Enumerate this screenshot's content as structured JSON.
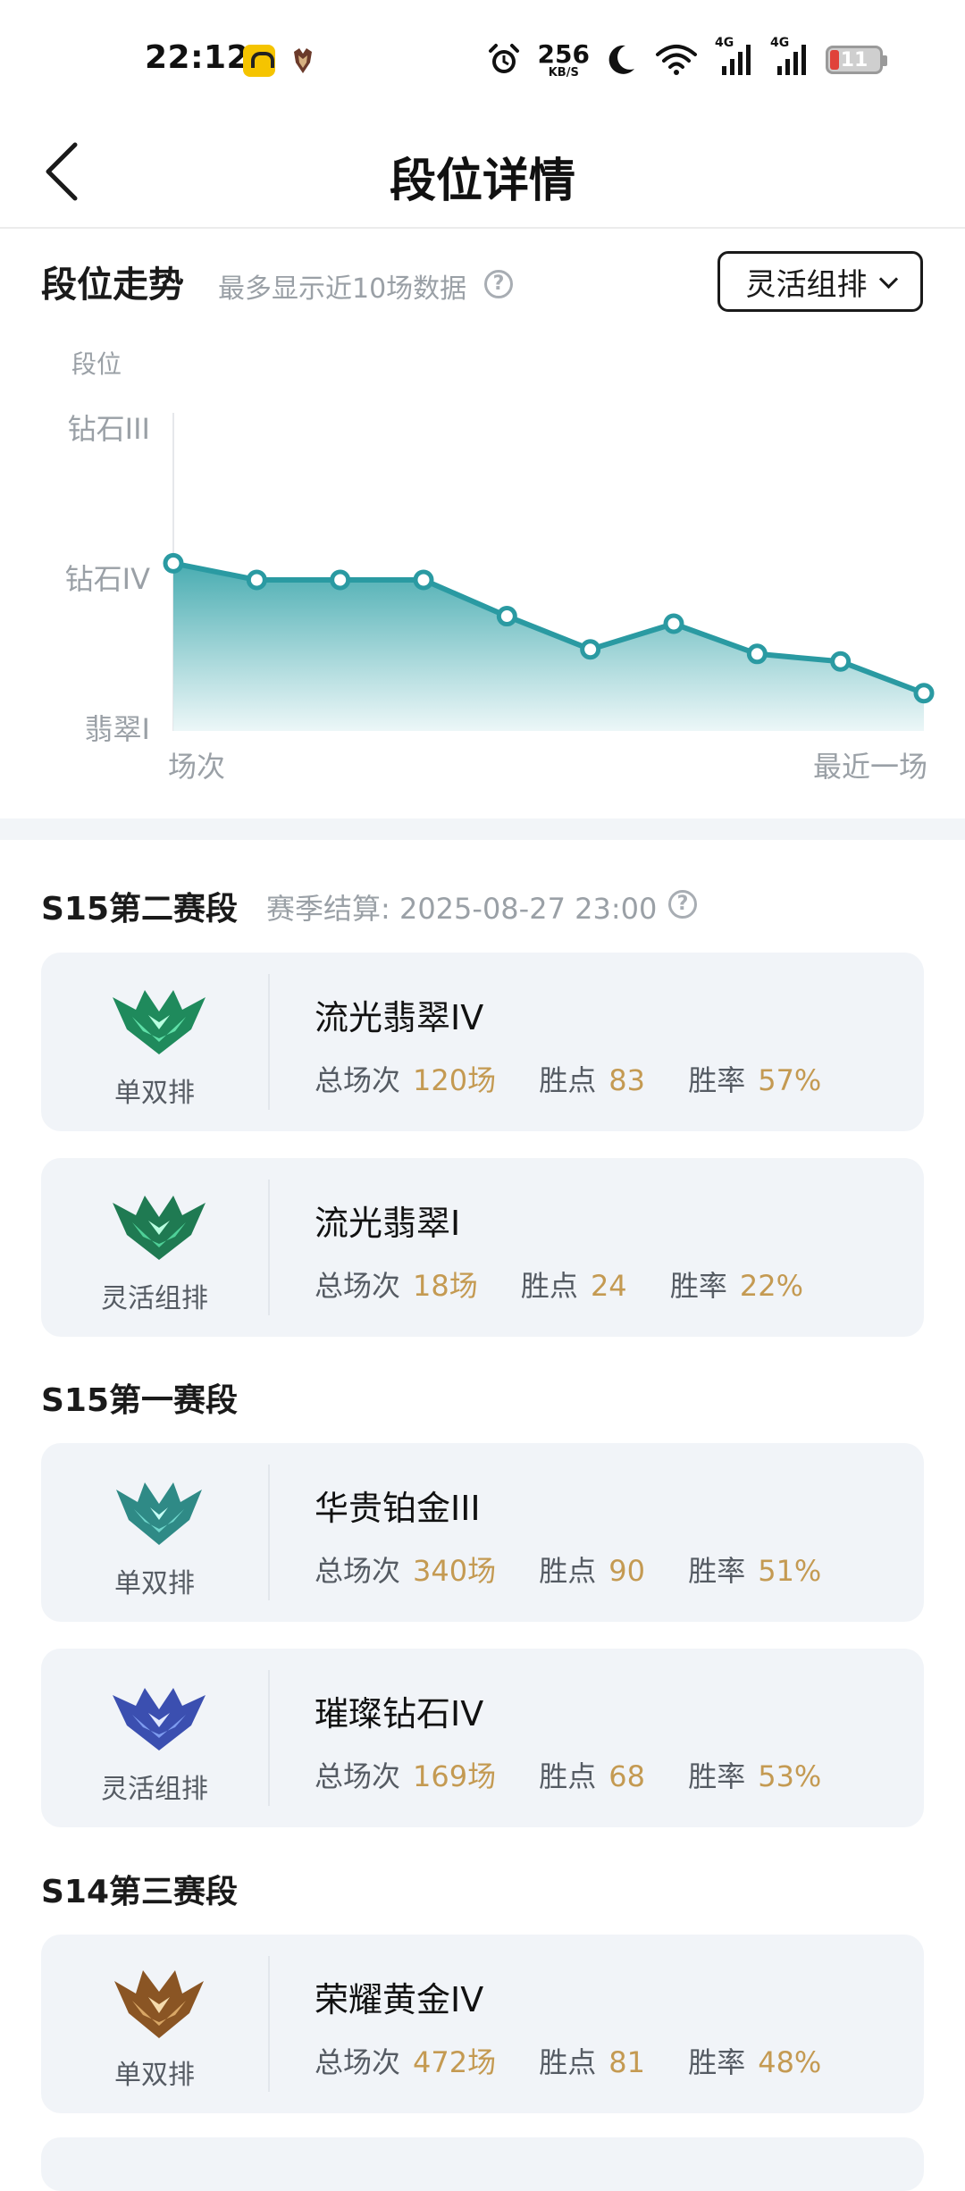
{
  "status_bar": {
    "time": "22:12",
    "net_speed_value": "256",
    "net_speed_unit": "KB/S",
    "signal1_label": "4G",
    "signal2_label": "4G",
    "battery_level": "11"
  },
  "header": {
    "title": "段位详情"
  },
  "trend": {
    "title": "段位走势",
    "subtitle": "最多显示近10场数据",
    "help_symbol": "?",
    "mode_selected": "灵活组排",
    "y_axis_title": "段位",
    "x_start_label": "场次",
    "x_end_label": "最近一场"
  },
  "chart_data": {
    "type": "area",
    "ylabel": "段位",
    "y_ticks": [
      "翡翠I",
      "钻石IV",
      "钻石III"
    ],
    "y_range": [
      0,
      2
    ],
    "x_start_label": "场次",
    "x_end_label": "最近一场",
    "values": [
      1.11,
      1.0,
      1.0,
      1.0,
      0.76,
      0.54,
      0.71,
      0.51,
      0.46,
      0.25
    ],
    "line_color": "#2a9aa2",
    "fill_color_top": "#3fa8ad",
    "fill_color_bottom": "#eaf6f7"
  },
  "seasons": [
    {
      "name": "S15第二赛段",
      "note": "赛季结算: 2025-08-27 23:00",
      "cards": [
        {
          "emblem": "emerald-emblem-icon",
          "queue": "单双排",
          "rank": "流光翡翠IV",
          "games_label": "总场次",
          "games": "120场",
          "lp_label": "胜点",
          "lp": "83",
          "wr_label": "胜率",
          "winrate": "57%"
        },
        {
          "emblem": "emerald-emblem-icon",
          "queue": "灵活组排",
          "rank": "流光翡翠I",
          "games_label": "总场次",
          "games": "18场",
          "lp_label": "胜点",
          "lp": "24",
          "wr_label": "胜率",
          "winrate": "22%"
        }
      ]
    },
    {
      "name": "S15第一赛段",
      "cards": [
        {
          "emblem": "platinum-emblem-icon",
          "queue": "单双排",
          "rank": "华贵铂金III",
          "games_label": "总场次",
          "games": "340场",
          "lp_label": "胜点",
          "lp": "90",
          "wr_label": "胜率",
          "winrate": "51%"
        },
        {
          "emblem": "diamond-emblem-icon",
          "queue": "灵活组排",
          "rank": "璀璨钻石IV",
          "games_label": "总场次",
          "games": "169场",
          "lp_label": "胜点",
          "lp": "68",
          "wr_label": "胜率",
          "winrate": "53%"
        }
      ]
    },
    {
      "name": "S14第三赛段",
      "cards": [
        {
          "emblem": "gold-emblem-icon",
          "queue": "单双排",
          "rank": "荣耀黄金IV",
          "games_label": "总场次",
          "games": "472场",
          "lp_label": "胜点",
          "lp": "81",
          "wr_label": "胜率",
          "winrate": "48%"
        }
      ]
    }
  ],
  "colors": {
    "accent_value": "#c49a52",
    "card_bg": "#f1f4f8",
    "emerald": "#1f8a5c",
    "platinum": "#2f8a86",
    "diamond": "#3b4fb0",
    "gold": "#a0692f"
  }
}
